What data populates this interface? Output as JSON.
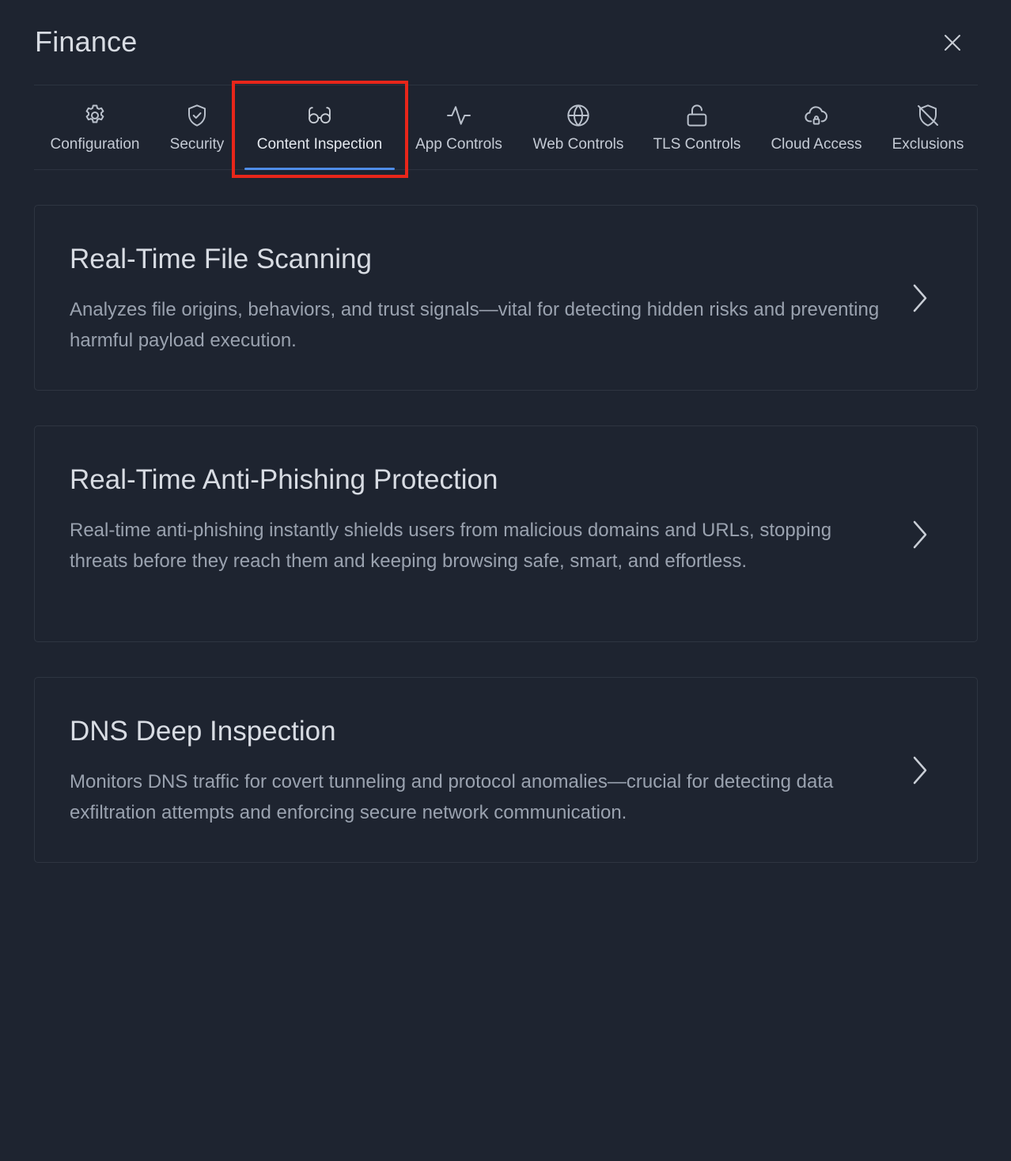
{
  "dialog": {
    "title": "Finance",
    "close_icon": "close-icon"
  },
  "tabs": [
    {
      "label": "Configuration",
      "icon": "gear-icon",
      "active": false
    },
    {
      "label": "Security",
      "icon": "shield-check-icon",
      "active": false
    },
    {
      "label": "Content Inspection",
      "icon": "glasses-icon",
      "active": true
    },
    {
      "label": "App Controls",
      "icon": "activity-icon",
      "active": false
    },
    {
      "label": "Web Controls",
      "icon": "globe-icon",
      "active": false
    },
    {
      "label": "TLS Controls",
      "icon": "unlock-icon",
      "active": false
    },
    {
      "label": "Cloud Access",
      "icon": "cloud-lock-icon",
      "active": false
    },
    {
      "label": "Exclusions",
      "icon": "shield-off-icon",
      "active": false
    }
  ],
  "cards": [
    {
      "title": "Real-Time File Scanning",
      "description": "Analyzes file origins, behaviors, and trust signals—vital for detecting hidden risks and preventing harmful payload execution."
    },
    {
      "title": "Real-Time Anti-Phishing Protection",
      "description": "Real-time anti-phishing instantly shields users from malicious domains and URLs, stopping threats before they reach them and keeping browsing safe, smart, and effortless."
    },
    {
      "title": "DNS Deep Inspection",
      "description": "Monitors DNS traffic for covert tunneling and protocol anomalies—crucial for detecting data exfiltration attempts and enforcing secure network communication."
    }
  ],
  "colors": {
    "background": "#1e2430",
    "accent": "#4f8de8",
    "highlight": "#e8261a",
    "text_primary": "#d8dce3",
    "text_secondary": "#9aa2af"
  }
}
